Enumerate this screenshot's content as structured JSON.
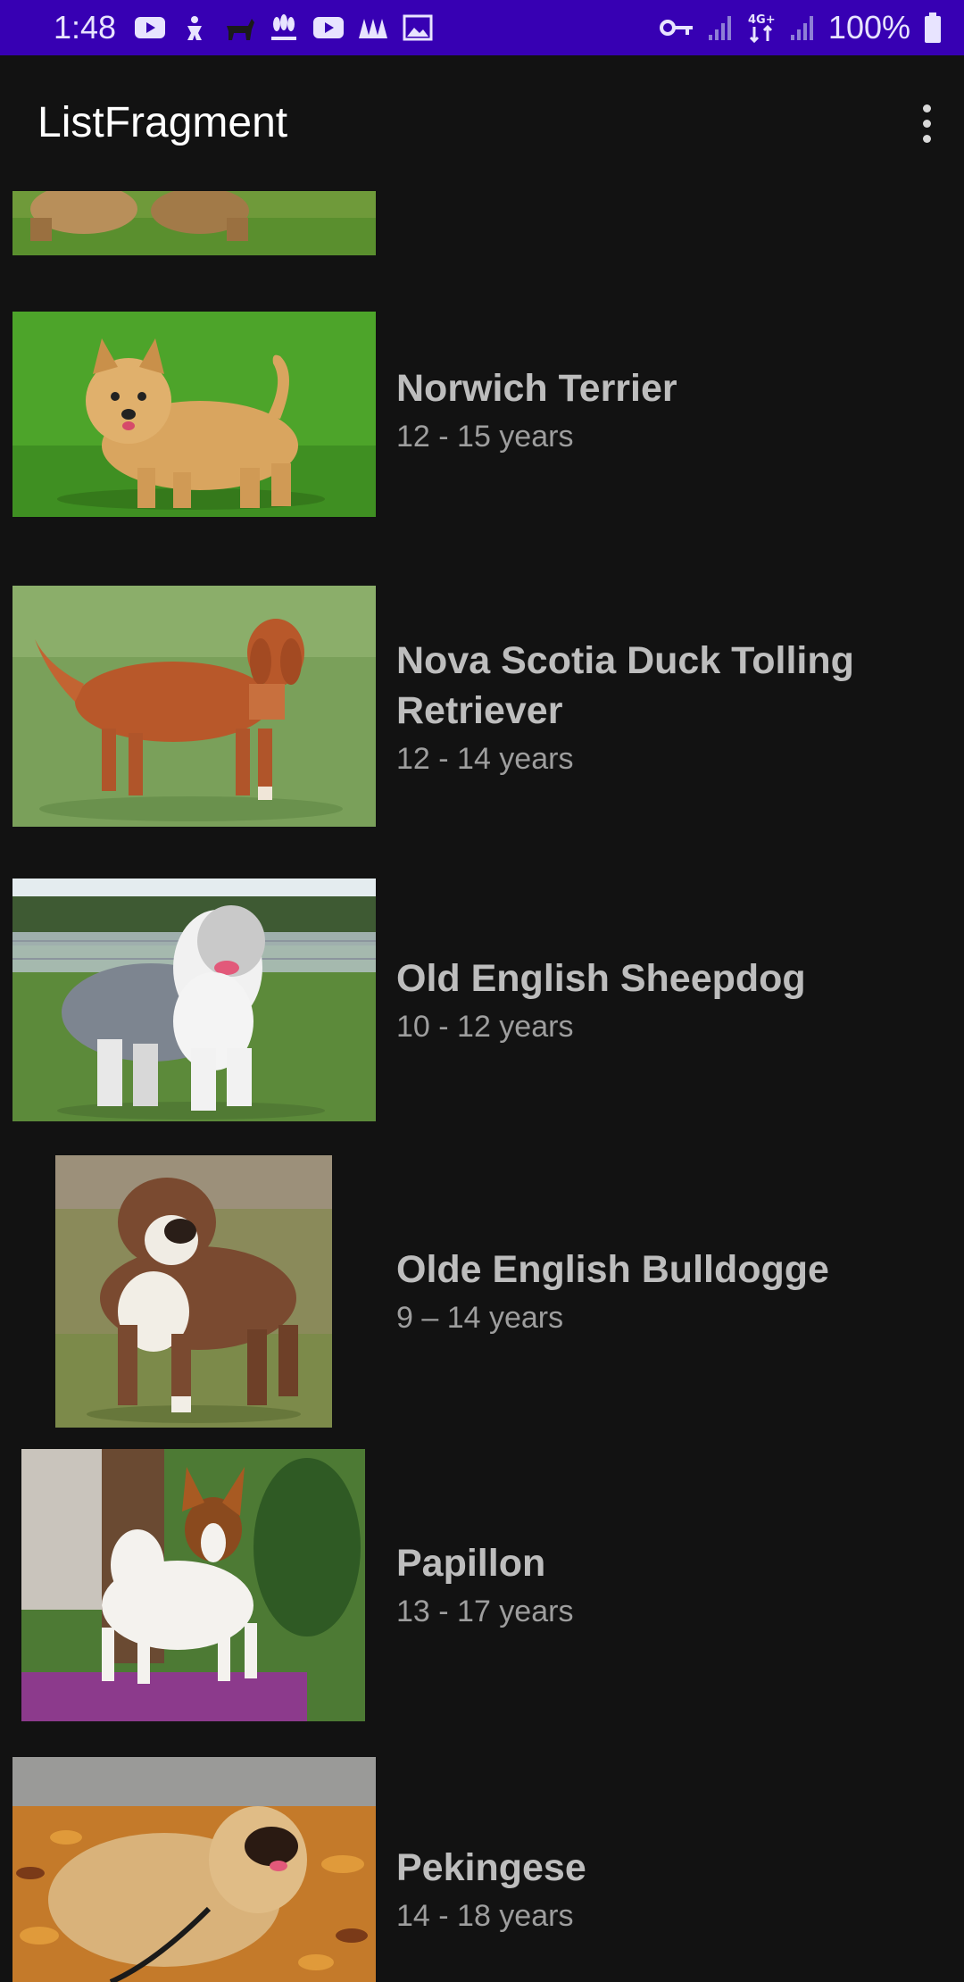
{
  "status_bar": {
    "time": "1:48",
    "battery": "100%",
    "icons_left": [
      "youtube-icon",
      "fitness-icon",
      "dog-icon",
      "nbc-news-icon",
      "youtube-icon",
      "app-icon",
      "image-icon"
    ],
    "icons_right": [
      "vpn-key-icon",
      "signal-icon",
      "4g-data-icon",
      "signal-icon",
      "battery-icon"
    ]
  },
  "app_bar": {
    "title": "ListFragment",
    "menu_icon": "overflow-menu-icon"
  },
  "breeds": [
    {
      "name": "",
      "life": ""
    },
    {
      "name": "Norwich Terrier",
      "life": "12 - 15 years"
    },
    {
      "name": "Nova Scotia Duck Tolling Retriever",
      "life": "12 - 14 years"
    },
    {
      "name": "Old English Sheepdog",
      "life": "10 - 12 years"
    },
    {
      "name": "Olde English Bulldogge",
      "life": "9 – 14 years"
    },
    {
      "name": "Papillon",
      "life": "13 - 17 years"
    },
    {
      "name": "Pekingese",
      "life": "14 - 18 years"
    }
  ],
  "colors": {
    "status_bar": "#3700b3",
    "background": "#121212",
    "title_text": "#ffffff",
    "name_text": "#bdbdbd",
    "life_text": "#9e9e9e"
  }
}
